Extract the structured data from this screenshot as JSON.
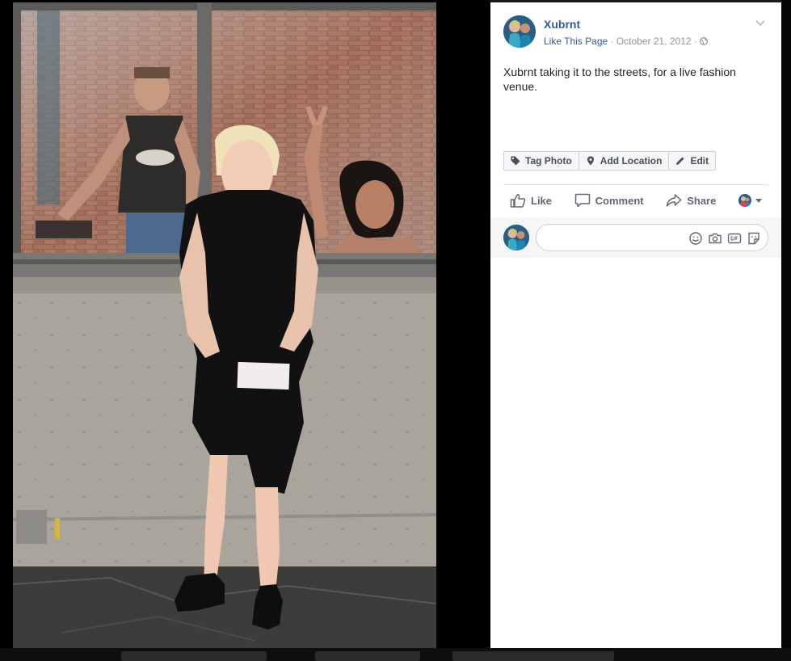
{
  "post": {
    "page_name": "Xubrnt",
    "like_page": "Like This Page",
    "separator": " · ",
    "date": "October 21, 2012",
    "caption": "Xubrnt taking it to the streets, for a live fashion venue."
  },
  "photo_actions": {
    "tag_photo": "Tag Photo",
    "add_location": "Add Location",
    "edit": "Edit"
  },
  "ufi": {
    "like": "Like",
    "comment": "Comment",
    "share": "Share"
  },
  "comment": {
    "placeholder": ""
  },
  "icons": [
    "chevron-down-icon",
    "globe-icon",
    "tag-icon",
    "location-pin-icon",
    "pencil-icon",
    "thumbs-up-icon",
    "comment-bubble-icon",
    "share-arrow-icon",
    "emoji-icon",
    "camera-icon",
    "gif-icon",
    "sticker-icon"
  ],
  "colors": {
    "link": "#385898",
    "meta": "#90949c",
    "text": "#1d2129",
    "button_text": "#606770",
    "border": "#ccd0d5"
  }
}
